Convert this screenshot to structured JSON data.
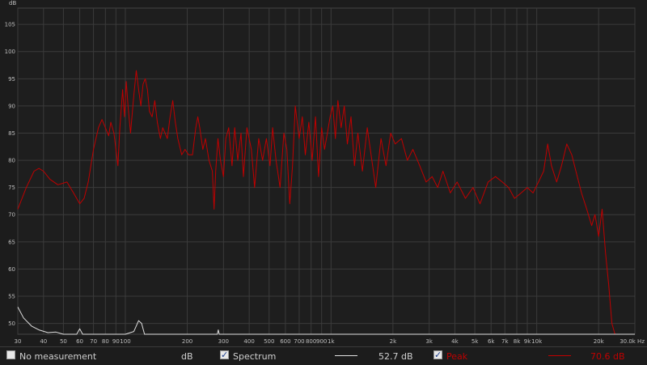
{
  "chart_data": {
    "type": "line",
    "x_scale": "log",
    "xlim": [
      30,
      30000
    ],
    "ylim": [
      48,
      108
    ],
    "ylabel": "dB",
    "x_ticks": [
      {
        "v": 30,
        "l": "30"
      },
      {
        "v": 40,
        "l": "40"
      },
      {
        "v": 50,
        "l": "50"
      },
      {
        "v": 60,
        "l": "60"
      },
      {
        "v": 70,
        "l": "70"
      },
      {
        "v": 80,
        "l": "80"
      },
      {
        "v": 90,
        "l": "90"
      },
      {
        "v": 100,
        "l": "100"
      },
      {
        "v": 200,
        "l": "200"
      },
      {
        "v": 300,
        "l": "300"
      },
      {
        "v": 400,
        "l": "400"
      },
      {
        "v": 500,
        "l": "500"
      },
      {
        "v": 600,
        "l": "600"
      },
      {
        "v": 700,
        "l": "700"
      },
      {
        "v": 800,
        "l": "800"
      },
      {
        "v": 900,
        "l": "900"
      },
      {
        "v": 1000,
        "l": "1k"
      },
      {
        "v": 2000,
        "l": "2k"
      },
      {
        "v": 3000,
        "l": "3k"
      },
      {
        "v": 4000,
        "l": "4k"
      },
      {
        "v": 5000,
        "l": "5k"
      },
      {
        "v": 6000,
        "l": "6k"
      },
      {
        "v": 7000,
        "l": "7k"
      },
      {
        "v": 8000,
        "l": "8k"
      },
      {
        "v": 9000,
        "l": "9k"
      },
      {
        "v": 10000,
        "l": "10k"
      },
      {
        "v": 20000,
        "l": "20k"
      },
      {
        "v": 30000,
        "l": "30.0k Hz"
      }
    ],
    "y_ticks": [
      50,
      55,
      60,
      65,
      70,
      75,
      80,
      85,
      90,
      95,
      100,
      105
    ],
    "grid": true,
    "series": [
      {
        "name": "Peak",
        "color": "#c00000",
        "points": [
          [
            30,
            71
          ],
          [
            33,
            75
          ],
          [
            36,
            78
          ],
          [
            38,
            78.5
          ],
          [
            40,
            78
          ],
          [
            43,
            76.5
          ],
          [
            47,
            75.5
          ],
          [
            52,
            76
          ],
          [
            56,
            74
          ],
          [
            60,
            72
          ],
          [
            63,
            73
          ],
          [
            66,
            76
          ],
          [
            70,
            82
          ],
          [
            74,
            86
          ],
          [
            77,
            87.5
          ],
          [
            80,
            86
          ],
          [
            83,
            84.5
          ],
          [
            85,
            87
          ],
          [
            88,
            85
          ],
          [
            92,
            79
          ],
          [
            94,
            86
          ],
          [
            97,
            93
          ],
          [
            99,
            88
          ],
          [
            101,
            94.5
          ],
          [
            103,
            90
          ],
          [
            106,
            85
          ],
          [
            110,
            92
          ],
          [
            113,
            96.5
          ],
          [
            116,
            93
          ],
          [
            119,
            90
          ],
          [
            122,
            94
          ],
          [
            125,
            95
          ],
          [
            128,
            93
          ],
          [
            131,
            89
          ],
          [
            135,
            88
          ],
          [
            139,
            91
          ],
          [
            143,
            87
          ],
          [
            148,
            84
          ],
          [
            152,
            86
          ],
          [
            156,
            85
          ],
          [
            160,
            84
          ],
          [
            165,
            88
          ],
          [
            170,
            91
          ],
          [
            175,
            87
          ],
          [
            180,
            84
          ],
          [
            188,
            81
          ],
          [
            195,
            82
          ],
          [
            203,
            81
          ],
          [
            212,
            81
          ],
          [
            220,
            86
          ],
          [
            225,
            88
          ],
          [
            230,
            86
          ],
          [
            238,
            82
          ],
          [
            245,
            84
          ],
          [
            255,
            80
          ],
          [
            265,
            78
          ],
          [
            270,
            71
          ],
          [
            275,
            78
          ],
          [
            282,
            84
          ],
          [
            290,
            80
          ],
          [
            300,
            77
          ],
          [
            308,
            84
          ],
          [
            318,
            86
          ],
          [
            330,
            79
          ],
          [
            340,
            86
          ],
          [
            352,
            80
          ],
          [
            365,
            85
          ],
          [
            375,
            77
          ],
          [
            390,
            86
          ],
          [
            410,
            82
          ],
          [
            425,
            75
          ],
          [
            445,
            84
          ],
          [
            465,
            80
          ],
          [
            485,
            84
          ],
          [
            505,
            79
          ],
          [
            520,
            86
          ],
          [
            540,
            80
          ],
          [
            565,
            75
          ],
          [
            590,
            85
          ],
          [
            610,
            82
          ],
          [
            630,
            72
          ],
          [
            650,
            79
          ],
          [
            670,
            90
          ],
          [
            700,
            84
          ],
          [
            725,
            88
          ],
          [
            750,
            81
          ],
          [
            780,
            87
          ],
          [
            810,
            80
          ],
          [
            840,
            88
          ],
          [
            870,
            77
          ],
          [
            900,
            86
          ],
          [
            930,
            82
          ],
          [
            960,
            85
          ],
          [
            990,
            88
          ],
          [
            1020,
            90
          ],
          [
            1050,
            84
          ],
          [
            1080,
            91
          ],
          [
            1120,
            86
          ],
          [
            1160,
            90
          ],
          [
            1200,
            83
          ],
          [
            1250,
            88
          ],
          [
            1300,
            79
          ],
          [
            1350,
            85
          ],
          [
            1420,
            78
          ],
          [
            1500,
            86
          ],
          [
            1580,
            80
          ],
          [
            1650,
            75
          ],
          [
            1750,
            84
          ],
          [
            1850,
            79
          ],
          [
            1950,
            85
          ],
          [
            2050,
            83
          ],
          [
            2200,
            84
          ],
          [
            2350,
            80
          ],
          [
            2500,
            82
          ],
          [
            2700,
            79
          ],
          [
            2900,
            76
          ],
          [
            3100,
            77
          ],
          [
            3300,
            75
          ],
          [
            3500,
            78
          ],
          [
            3800,
            74
          ],
          [
            4100,
            76
          ],
          [
            4500,
            73
          ],
          [
            4900,
            75
          ],
          [
            5300,
            72
          ],
          [
            5800,
            76
          ],
          [
            6300,
            77
          ],
          [
            6800,
            76
          ],
          [
            7300,
            75
          ],
          [
            7800,
            73
          ],
          [
            8400,
            74
          ],
          [
            9000,
            75
          ],
          [
            9600,
            74
          ],
          [
            10200,
            76
          ],
          [
            10800,
            78
          ],
          [
            11300,
            83
          ],
          [
            11800,
            79
          ],
          [
            12500,
            76
          ],
          [
            13200,
            79
          ],
          [
            14000,
            83
          ],
          [
            14800,
            81
          ],
          [
            15500,
            78
          ],
          [
            16500,
            74
          ],
          [
            17500,
            71
          ],
          [
            18500,
            68
          ],
          [
            19200,
            70
          ],
          [
            20000,
            66
          ],
          [
            20800,
            71
          ],
          [
            21600,
            63
          ],
          [
            22400,
            57
          ],
          [
            23200,
            50
          ],
          [
            24000,
            48
          ]
        ]
      },
      {
        "name": "Spectrum",
        "color": "#e0e0e0",
        "points": [
          [
            30,
            53
          ],
          [
            32,
            51
          ],
          [
            35,
            49.5
          ],
          [
            38,
            48.8
          ],
          [
            42,
            48.3
          ],
          [
            46,
            48.4
          ],
          [
            50,
            48
          ],
          [
            58,
            48
          ],
          [
            60,
            49
          ],
          [
            62,
            48
          ],
          [
            100,
            48
          ],
          [
            110,
            48.5
          ],
          [
            116,
            50.5
          ],
          [
            120,
            50
          ],
          [
            124,
            48
          ],
          [
            280,
            48
          ],
          [
            283,
            48.8
          ],
          [
            286,
            48
          ],
          [
            30000,
            48
          ]
        ]
      }
    ]
  },
  "legend": {
    "no_measurement_label": "No measurement",
    "no_measurement_checked": false,
    "unit_label": "dB",
    "spectrum_label": "Spectrum",
    "spectrum_checked": true,
    "spectrum_value": "52.7 dB",
    "peak_label": "Peak",
    "peak_checked": true,
    "peak_value": "70.6 dB"
  }
}
